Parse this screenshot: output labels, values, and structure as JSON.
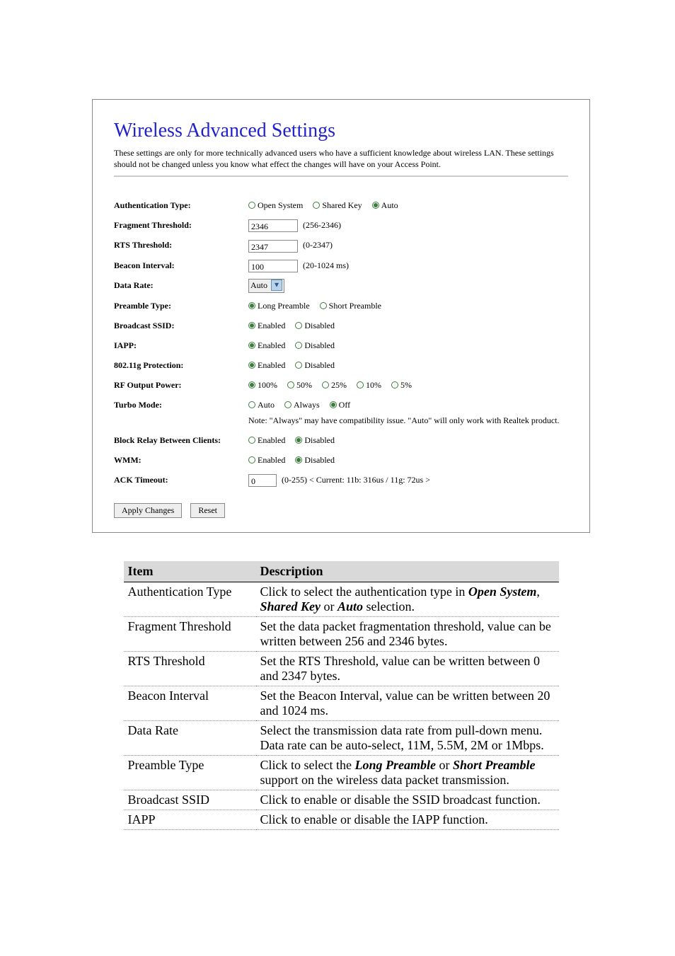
{
  "panel": {
    "title": "Wireless Advanced Settings",
    "description": "These settings are only for more technically advanced users who have a sufficient knowledge about wireless LAN. These settings should not be changed unless you know what effect the changes will have on your Access Point."
  },
  "form": {
    "auth": {
      "label": "Authentication Type:",
      "options": [
        "Open System",
        "Shared Key",
        "Auto"
      ],
      "selected": 2
    },
    "frag": {
      "label": "Fragment Threshold:",
      "value": "2346",
      "hint": "(256-2346)"
    },
    "rts": {
      "label": "RTS Threshold:",
      "value": "2347",
      "hint": "(0-2347)"
    },
    "beacon": {
      "label": "Beacon Interval:",
      "value": "100",
      "hint": "(20-1024 ms)"
    },
    "datarate": {
      "label": "Data Rate:",
      "value": "Auto"
    },
    "preamble": {
      "label": "Preamble Type:",
      "options": [
        "Long Preamble",
        "Short Preamble"
      ],
      "selected": 0
    },
    "bssid": {
      "label": "Broadcast SSID:",
      "options": [
        "Enabled",
        "Disabled"
      ],
      "selected": 0
    },
    "iapp": {
      "label": "IAPP:",
      "options": [
        "Enabled",
        "Disabled"
      ],
      "selected": 0
    },
    "prot": {
      "label": "802.11g Protection:",
      "options": [
        "Enabled",
        "Disabled"
      ],
      "selected": 0
    },
    "rfpower": {
      "label": "RF Output Power:",
      "options": [
        "100%",
        "50%",
        "25%",
        "10%",
        "5%"
      ],
      "selected": 0
    },
    "turbo": {
      "label": "Turbo Mode:",
      "options": [
        "Auto",
        "Always",
        "Off"
      ],
      "selected": 2,
      "note": "Note: \"Always\" may have compatibility issue. \"Auto\" will only work with Realtek product."
    },
    "blockrelay": {
      "label": "Block Relay Between Clients:",
      "options": [
        "Enabled",
        "Disabled"
      ],
      "selected": 1
    },
    "wmm": {
      "label": "WMM:",
      "options": [
        "Enabled",
        "Disabled"
      ],
      "selected": 1
    },
    "ack": {
      "label": "ACK Timeout:",
      "value": "0",
      "hint": "(0-255)  < Current: 11b: 316us / 11g: 72us >"
    },
    "buttons": {
      "apply": "Apply Changes",
      "reset": "Reset"
    }
  },
  "table": {
    "head_item": "Item",
    "head_desc": "Description",
    "rows": [
      {
        "item": "Authentication Type",
        "desc_pre": "Click to select the authentication type in ",
        "b1": "Open System",
        "sep1": ", ",
        "b2": "Shared Key",
        "sep2": " or ",
        "b3": "Auto",
        "desc_post": " selection."
      },
      {
        "item": "Fragment Threshold",
        "desc": "Set the data packet fragmentation threshold, value can be written between 256 and 2346 bytes."
      },
      {
        "item": "RTS Threshold",
        "desc": "Set the RTS Threshold, value can be written between 0 and 2347 bytes."
      },
      {
        "item": "Beacon Interval",
        "desc": "Set the Beacon Interval, value can be written between 20 and 1024 ms."
      },
      {
        "item": "Data Rate",
        "desc": "Select the transmission data rate from pull-down menu. Data rate can be auto-select, 11M, 5.5M, 2M or 1Mbps."
      },
      {
        "item": "Preamble Type",
        "desc_pre": "Click to select the ",
        "b1": "Long Preamble",
        "sep1": " or ",
        "b2": "Short Preamble",
        "desc_post": " support on the wireless data packet transmission."
      },
      {
        "item": "Broadcast SSID",
        "desc": "Click to enable or disable the SSID broadcast function."
      },
      {
        "item": "IAPP",
        "desc": "Click to enable or disable the IAPP function."
      }
    ]
  }
}
